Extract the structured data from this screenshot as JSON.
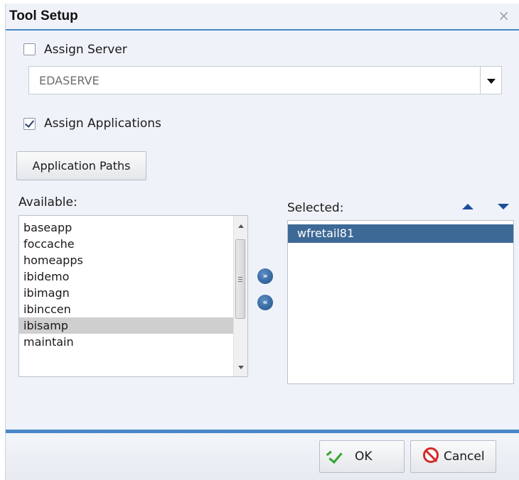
{
  "dialog": {
    "title": "Tool Setup",
    "close_icon": "×"
  },
  "assign_server": {
    "label": "Assign Server",
    "checked": false,
    "server_value": "EDASERVE"
  },
  "assign_applications": {
    "label": "Assign Applications",
    "checked": true
  },
  "application_paths_button": "Application Paths",
  "available": {
    "label": "Available:",
    "items": [
      "baseapp",
      "foccache",
      "homeapps",
      "ibidemo",
      "ibimagn",
      "ibinccen",
      "ibisamp",
      "maintain"
    ],
    "highlighted": "ibisamp"
  },
  "move_buttons": {
    "add_glyph": "»",
    "remove_glyph": "«"
  },
  "selected": {
    "label": "Selected:",
    "items": [
      "wfretail81"
    ],
    "active": "wfretail81"
  },
  "footer": {
    "ok_label": "OK",
    "cancel_label": "Cancel"
  },
  "colors": {
    "accent_blue": "#4a86c8",
    "selected_row": "#3d6996",
    "ok_green": "#33a52f",
    "cancel_red": "#d52a2a"
  }
}
